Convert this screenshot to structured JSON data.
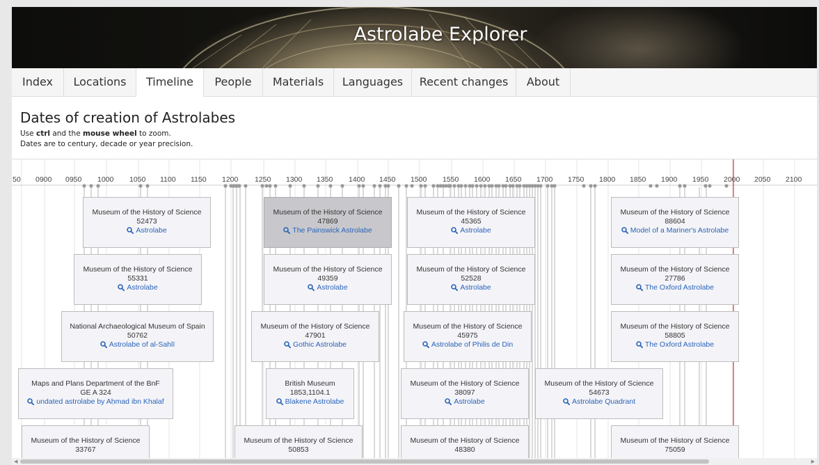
{
  "app": {
    "title": "Astrolabe Explorer"
  },
  "tabs": [
    {
      "label": "Index"
    },
    {
      "label": "Locations"
    },
    {
      "label": "Timeline"
    },
    {
      "label": "People"
    },
    {
      "label": "Materials"
    },
    {
      "label": "Languages"
    },
    {
      "label": "Recent changes"
    },
    {
      "label": "About"
    }
  ],
  "active_tab": "Timeline",
  "page": {
    "heading": "Dates of creation of Astrolabes",
    "help_line1": {
      "prefix": "Use ",
      "key1": "ctrl",
      "mid": " and the ",
      "key2": "mouse wheel",
      "suffix": " to zoom."
    },
    "help_line2": "Dates are to century, decade or year precision."
  },
  "timeline": {
    "axis_labels": [
      "50",
      "0900",
      "0950",
      "1000",
      "1050",
      "1100",
      "1150",
      "1200",
      "1250",
      "1300",
      "1350",
      "1400",
      "1450",
      "1500",
      "1550",
      "1600",
      "1650",
      "1700",
      "1750",
      "1800",
      "1850",
      "1900",
      "1950",
      "2000",
      "2050",
      "2100"
    ],
    "current_year_marker_color": "#e04040",
    "cards": [
      {
        "institution": "Museum of the History of Science",
        "accession": "52473",
        "name": "Astrolabe"
      },
      {
        "institution": "Museum of the History of Science",
        "accession": "47869",
        "name": "The Painswick Astrolabe",
        "highlighted": true
      },
      {
        "institution": "Museum of the History of Science",
        "accession": "45365",
        "name": "Astrolabe"
      },
      {
        "institution": "Museum of the History of Science",
        "accession": "88604",
        "name": "Model of a Mariner's Astrolabe"
      },
      {
        "institution": "Museum of the History of Science",
        "accession": "55331",
        "name": "Astrolabe"
      },
      {
        "institution": "Museum of the History of Science",
        "accession": "49359",
        "name": "Astrolabe"
      },
      {
        "institution": "Museum of the History of Science",
        "accession": "52528",
        "name": "Astrolabe"
      },
      {
        "institution": "Museum of the History of Science",
        "accession": "27786",
        "name": "The Oxford Astrolabe"
      },
      {
        "institution": "National Archaeological Museum of Spain",
        "accession": "50762",
        "name": "Astrolabe of al-Sahlī"
      },
      {
        "institution": "Museum of the History of Science",
        "accession": "47901",
        "name": "Gothic Astrolabe"
      },
      {
        "institution": "Museum of the History of Science",
        "accession": "45975",
        "name": "Astrolabe of Philis de Din"
      },
      {
        "institution": "Museum of the History of Science",
        "accession": "58805",
        "name": "The Oxford Astrolabe"
      },
      {
        "institution": "Maps and Plans Department of the BnF",
        "accession": "GE A 324",
        "name": "undated astrolabe by Aḥmad ibn Khalaf"
      },
      {
        "institution": "British Museum",
        "accession": "1853,1104.1",
        "name": "Blakene Astrolabe"
      },
      {
        "institution": "Museum of the History of Science",
        "accession": "38097",
        "name": "Astrolabe"
      },
      {
        "institution": "Museum of the History of Science",
        "accession": "54673",
        "name": "Astrolabe Quadrant"
      },
      {
        "institution": "Museum of the History of Science",
        "accession": "33767",
        "name": ""
      },
      {
        "institution": "Museum of the History of Science",
        "accession": "50853",
        "name": ""
      },
      {
        "institution": "Museum of the History of Science",
        "accession": "48380",
        "name": ""
      },
      {
        "institution": "Museum of the History of Science",
        "accession": "75059",
        "name": ""
      }
    ]
  },
  "icons": {
    "search": "magnifier-icon"
  },
  "colors": {
    "link": "#2a63b8",
    "card_bg": "#f4f4f8",
    "card_highlight": "#c8c8cc",
    "marker": "#e04040"
  }
}
